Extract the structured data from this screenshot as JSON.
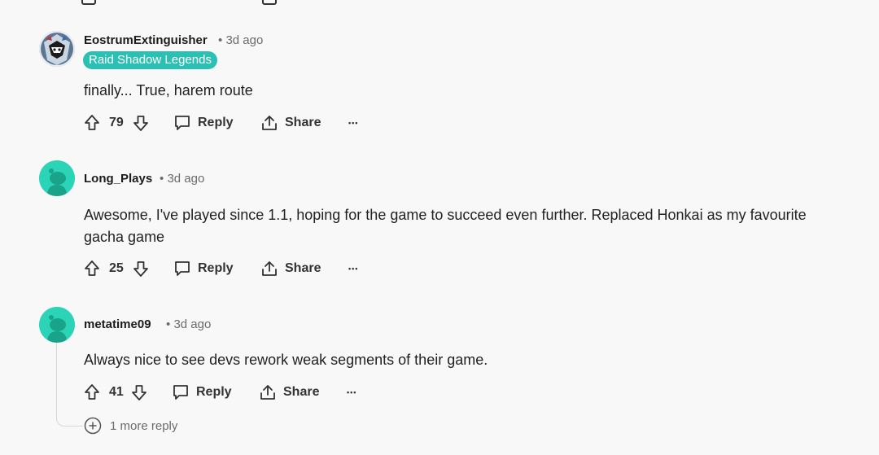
{
  "comments": [
    {
      "username": "EostrumExtinguisher",
      "age": "3d ago",
      "flair": "Raid Shadow Legends",
      "text": "finally... True, harem route",
      "score": "79",
      "reply_label": "Reply",
      "share_label": "Share",
      "more_glyph": "•••"
    },
    {
      "username": "Long_Plays",
      "age": "3d ago",
      "text_line1": "Awesome, I've played since 1.1, hoping for the game to succeed even further. Replaced Honkai as my favourite",
      "text_line2": "gacha game",
      "score": "25",
      "reply_label": "Reply",
      "share_label": "Share",
      "more_glyph": "•••"
    },
    {
      "username": "metatime09",
      "age": "3d ago",
      "text": "Always nice to see devs rework weak segments of their game.",
      "score": "41",
      "reply_label": "Reply",
      "share_label": "Share",
      "more_glyph": "•••"
    }
  ],
  "more_replies": "1 more reply",
  "meta_separator": "•",
  "colors": {
    "flair_bg": "#2ac0b3",
    "avatar_teal": "#2bd4b7",
    "background": "#f8f8f8"
  }
}
